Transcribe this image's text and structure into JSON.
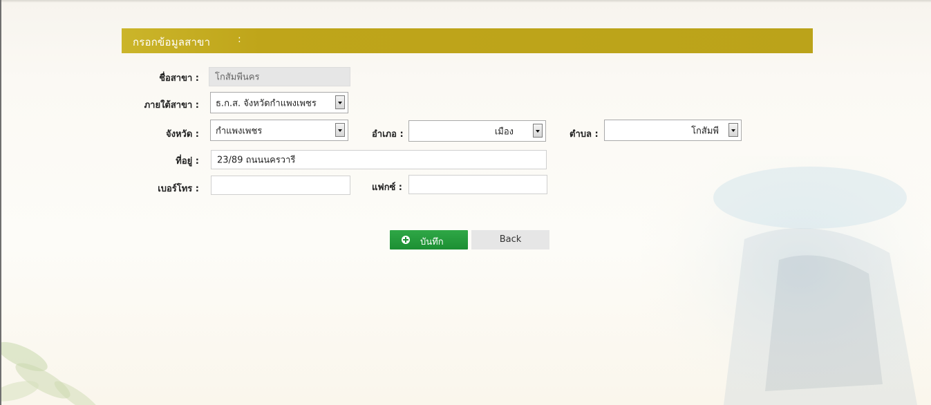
{
  "form": {
    "header_title": "กรอกข้อมูลสาขา",
    "header_colon": ":",
    "fields": {
      "branch_name": {
        "label": "ชื่อสาขา :",
        "value": "โกสัมพีนคร"
      },
      "parent_branch": {
        "label": "ภายใต้สาขา :",
        "value": "ธ.ก.ส. จังหวัดกำแพงเพชร"
      },
      "province": {
        "label": "จังหวัด :",
        "value": "กำแพงเพชร"
      },
      "district": {
        "label": "อำเภอ :",
        "value": "เมือง"
      },
      "subdistrict": {
        "label": "ตำบล :",
        "value": "โกสัมพี"
      },
      "address": {
        "label": "ที่อยู่ :",
        "value": "23/89 ถนนนครวารี"
      },
      "phone": {
        "label": "เบอร์โทร :",
        "value": ""
      },
      "fax": {
        "label": "แฟกซ์ :",
        "value": ""
      }
    },
    "buttons": {
      "save_label": "บันทึก",
      "back_label": "Back"
    }
  },
  "colors": {
    "header_bar": "#bfa51a",
    "save_button": "#1c8f33",
    "back_button": "#e6e6e6"
  }
}
